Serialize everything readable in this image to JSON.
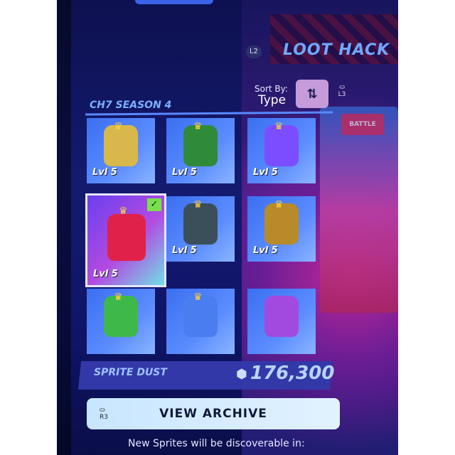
{
  "header": {
    "l2_badge": "L2",
    "title": "LOOT HACK",
    "l3_badge": "L3"
  },
  "sort": {
    "label": "Sort By:",
    "value": "Type",
    "icon": "sort-arrows-icon"
  },
  "section": {
    "title": "CH7 SEASON 4"
  },
  "sprites": [
    {
      "level": "Lvl 5",
      "color": "#d8b84a",
      "crown": true,
      "selected": false
    },
    {
      "level": "Lvl 5",
      "color": "#2f8a3a",
      "crown": true,
      "selected": false
    },
    {
      "level": "Lvl 5",
      "color": "#7c4dff",
      "crown": true,
      "selected": false
    },
    {
      "level": "Lvl 5",
      "color": "#e0224a",
      "crown": true,
      "selected": true
    },
    {
      "level": "Lvl 5",
      "color": "#3b4f5a",
      "crown": true,
      "selected": false
    },
    {
      "level": "Lvl 5",
      "color": "#b88a2a",
      "crown": true,
      "selected": false
    },
    {
      "level": "",
      "color": "#3fb84a",
      "crown": true,
      "selected": false
    },
    {
      "level": "",
      "color": "#4a7df0",
      "crown": true,
      "selected": false
    },
    {
      "level": "",
      "color": "#a24ae0",
      "crown": false,
      "selected": false
    }
  ],
  "dust": {
    "label": "SPRITE DUST",
    "value": "176,300"
  },
  "archive": {
    "label": "VIEW ARCHIVE",
    "badge": "R3"
  },
  "footer": {
    "text": "New Sprites will be discoverable in:"
  }
}
